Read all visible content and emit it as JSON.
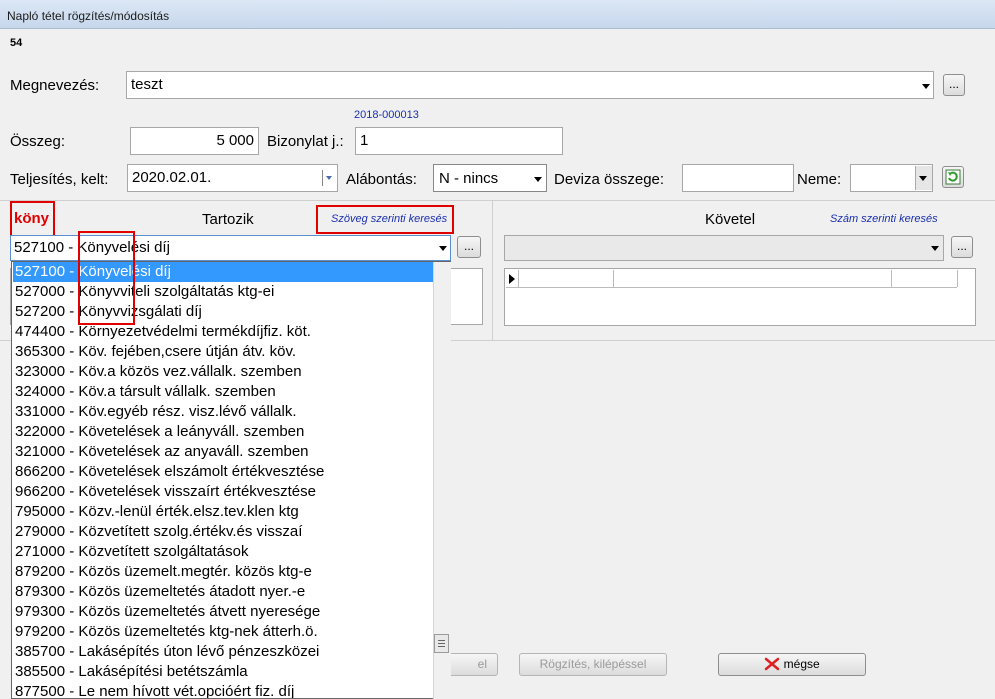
{
  "window": {
    "title": "Napló tétel rögzítés/módosítás",
    "record_id": "54"
  },
  "form": {
    "name_label": "Megnevezés:",
    "name_value": "teszt",
    "doc_number_hint": "2018-000013",
    "amount_label": "Összeg:",
    "amount_value": "5 000",
    "doc_label": "Bizonylat j.:",
    "doc_value": "1",
    "date_label": "Teljesítés, kelt:",
    "date_value": "2020.02.01.",
    "subtype_label": "Alábontás:",
    "subtype_value": "N - nincs",
    "fx_label": "Deviza összege:",
    "fx_value": "",
    "currency_label": "Neme:",
    "currency_value": ""
  },
  "debit": {
    "search_text": "köny",
    "header": "Tartozik",
    "search_mode": "Szöveg szerinti keresés",
    "selected": "527100 - Könyvelési díj"
  },
  "credit": {
    "header": "Követel",
    "search_mode": "Szám szerinti keresés",
    "selected": ""
  },
  "dropdown_items": [
    "527100 - Könyvelési díj",
    "527000 - Könyvviteli szolgáltatás ktg-ei",
    "527200 - Könyvvizsgálati díj",
    "474400 - Környezetvédelmi termékdíjfiz. köt.",
    "365300 - Köv. fejében,csere útján átv. köv.",
    "323000 - Köv.a közös vez.vállalk. szemben",
    "324000 - Köv.a társult vállalk. szemben",
    "331000 - Köv.egyéb rész. visz.lévő vállalk.",
    "322000 - Követelések a leányváll. szemben",
    "321000 - Követelések az anyaváll. szemben",
    "866200 - Követelések elszámolt értékvesztése",
    "966200 - Követelések visszaírt értékvesztése",
    "795000 - Közv.-lenül érték.elsz.tev.klen ktg",
    "279000 - Közvetített szolg.értékv.és visszaí",
    "271000 - Közvetített szolgáltatások",
    "879200 - Közös üzemelt.megtér. közös ktg-e",
    "879300 - Közös üzemeltetés átadott nyer.-e",
    "979300 - Közös üzemeltetés átvett nyeresége",
    "979200 - Közös üzemeltetés ktg-nek átterh.ö.",
    "385700 - Lakásépítés úton lévő pénzeszközei",
    "385500 - Lakásépítési betétszámla",
    "877500 - Le nem hívott vét.opcióért fiz. díj"
  ],
  "buttons": {
    "ellipsis": "...",
    "partial_left": "el",
    "save_exit": "Rögzítés, kilépéssel",
    "cancel": "mégse"
  },
  "colors": {
    "selection": "#3399ff",
    "highlight_red": "#e00000",
    "link_blue": "#1a2fb0"
  }
}
